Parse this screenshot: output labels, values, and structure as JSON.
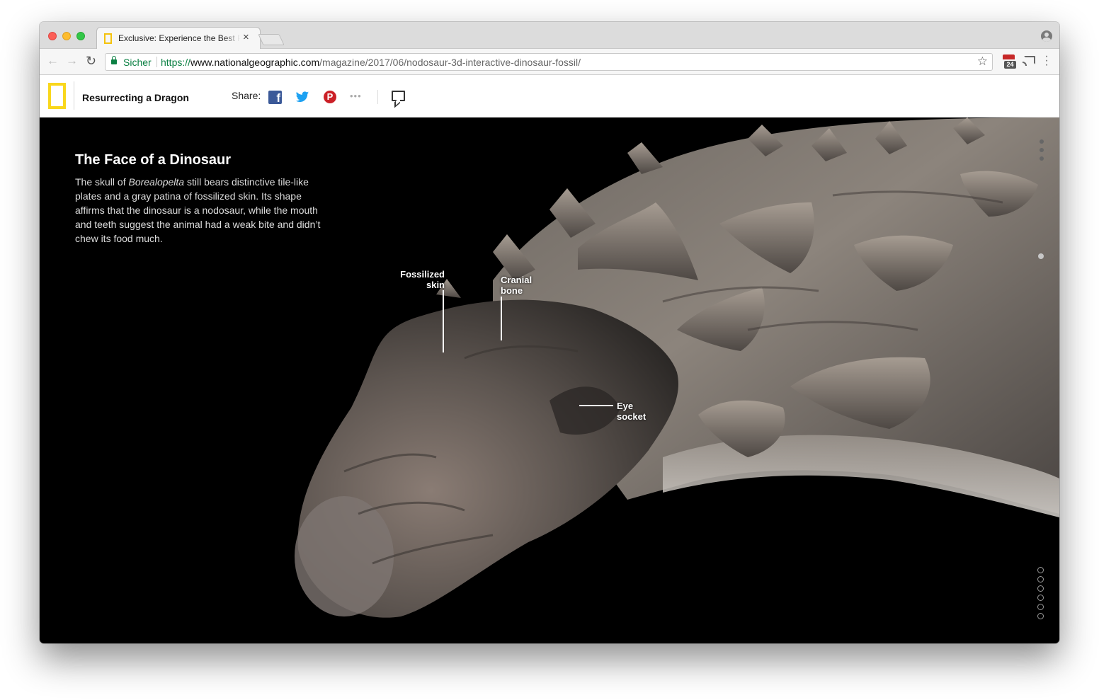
{
  "browser": {
    "tab_title": "Exclusive: Experience the Best Preserved Dinosaur Ever Found",
    "tab_close": "×",
    "secure_label": "Sicher",
    "url_scheme": "https://",
    "url_host": "www.nationalgeographic.com",
    "url_path": "/magazine/2017/06/nodosaur-3d-interactive-dinosaur-fossil/",
    "extension_badge": "24",
    "icons": [
      "back-icon",
      "forward-icon",
      "reload-icon",
      "lock-icon",
      "star-icon",
      "calendar-extension-icon",
      "cast-icon",
      "menu-icon",
      "profile-icon"
    ]
  },
  "header": {
    "story_title": "Resurrecting a Dragon",
    "share_label": "Share:",
    "facebook_glyph": "f",
    "pinterest_glyph": "P",
    "more_glyph": "•••",
    "brand_color": "#f9d71c"
  },
  "article": {
    "headline": "The Face of a Dinosaur",
    "body_before": "The skull of ",
    "body_species": "Borealopelta",
    "body_after": " still bears distinctive tile-like plates and a gray patina of fossilized skin. Its shape affirms that the dinosaur is a nodosaur, while the mouth and teeth suggest the animal had a weak bite and didn’t chew its food much."
  },
  "annotations": {
    "skin_line1": "Fossilized",
    "skin_line2": "skin",
    "cranial_line1": "Cranial",
    "cranial_line2": "bone",
    "eye_line1": "Eye",
    "eye_line2": "socket"
  },
  "navigation": {
    "section_count": 6,
    "active_section": 0
  }
}
